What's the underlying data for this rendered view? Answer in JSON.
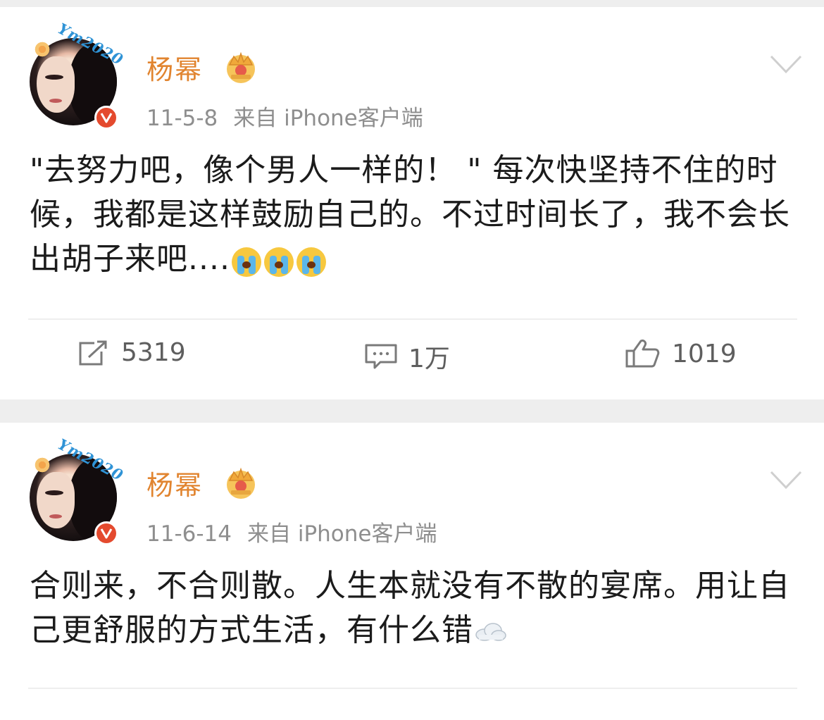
{
  "posts": [
    {
      "author": "杨幂",
      "date": "11-5-8",
      "source": "来自 iPhone客户端",
      "text": "\"去努力吧，像个男人一样的！ \" 每次快坚持不住的时候，我都是这样鼓励自己的。不过时间长了，我不会长出胡子来吧....",
      "emoji": [
        "crying-face",
        "crying-face",
        "crying-face"
      ],
      "repost_count": "5319",
      "comment_count": "1万",
      "like_count": "1019"
    },
    {
      "author": "杨幂",
      "date": "11-6-14",
      "source": "来自 iPhone客户端",
      "text": "合则来，不合则散。人生本就没有不散的宴席。用让自己更舒服的方式生活，有什么错",
      "emoji": [
        "cloud"
      ]
    }
  ],
  "avatar_frame_text": "Ym2020",
  "colors": {
    "author_name": "#e1842f",
    "meta": "#8e8e8e",
    "verified_badge": "#e44a2e",
    "body_text": "#1b1b1b",
    "background": "#eeeeee"
  },
  "icons": [
    "chevron-down-icon",
    "verified-v-icon",
    "crown-icon",
    "repost-icon",
    "comment-icon",
    "like-icon"
  ]
}
